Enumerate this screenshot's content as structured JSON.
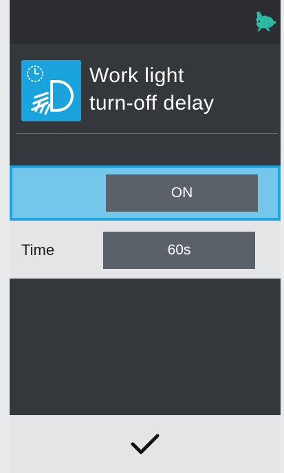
{
  "topbar": {
    "status_icon": "rabbit-icon",
    "status_icon_color": "#2fb9a5"
  },
  "header": {
    "icon": "work-light-timer-icon",
    "icon_color": "#1aa3dd",
    "title_line1": "Work light",
    "title_line2": "turn-off delay"
  },
  "settings": {
    "mode_value": "ON",
    "time_label": "Time",
    "time_value": "60s"
  },
  "footer": {
    "confirm_icon": "checkmark-icon"
  },
  "colors": {
    "screen_bg": "#34373b",
    "selected_row": "#74c6ea",
    "selected_border": "#1aa3dd",
    "value_box": "#5a6169",
    "light_row": "#e4e5e6"
  }
}
